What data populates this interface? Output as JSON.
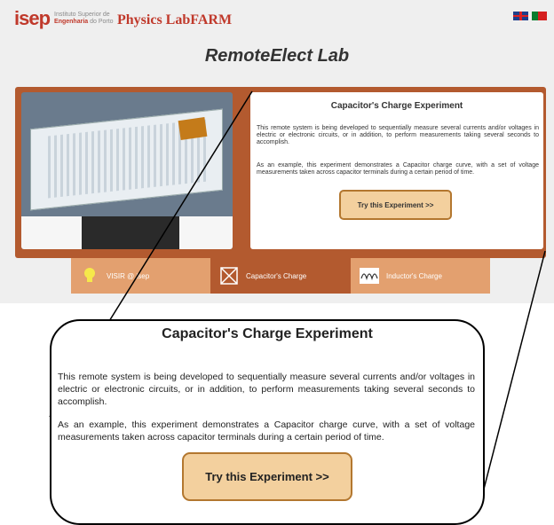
{
  "header": {
    "logo_text": "isep",
    "institute_line1": "Instituto Superior de",
    "institute_line2_bold": "Engenharia",
    "institute_line2_rest": "do Porto",
    "brand": "Physics LabFARM",
    "languages": [
      "en-flag-icon",
      "pt-flag-icon"
    ]
  },
  "lab_title": "RemoteElect Lab",
  "experiment": {
    "title": "Capacitor's Charge Experiment",
    "paragraph1": "This remote system is being developed to sequentially measure several currents and/or voltages in electric or electronic circuits, or in addition, to perform measurements taking several seconds to accomplish.",
    "paragraph2": "As an example, this experiment demonstrates a Capacitor charge curve, with a set of voltage measurements taken across capacitor terminals during a certain period of time.",
    "button_label": "Try this Experiment >>"
  },
  "tabs": [
    {
      "label": "VISIR @ isep",
      "icon": "lightbulb-icon"
    },
    {
      "label": "Capacitor's Charge",
      "icon": "capacitor-icon"
    },
    {
      "label": "Inductor's Charge",
      "icon": "coil-icon"
    }
  ],
  "colors": {
    "brand_red": "#c0392b",
    "frame_brown": "#b35a2f",
    "tab_light": "#e3a06f",
    "button_fill": "#f3d09e",
    "button_border": "#b3772f"
  }
}
